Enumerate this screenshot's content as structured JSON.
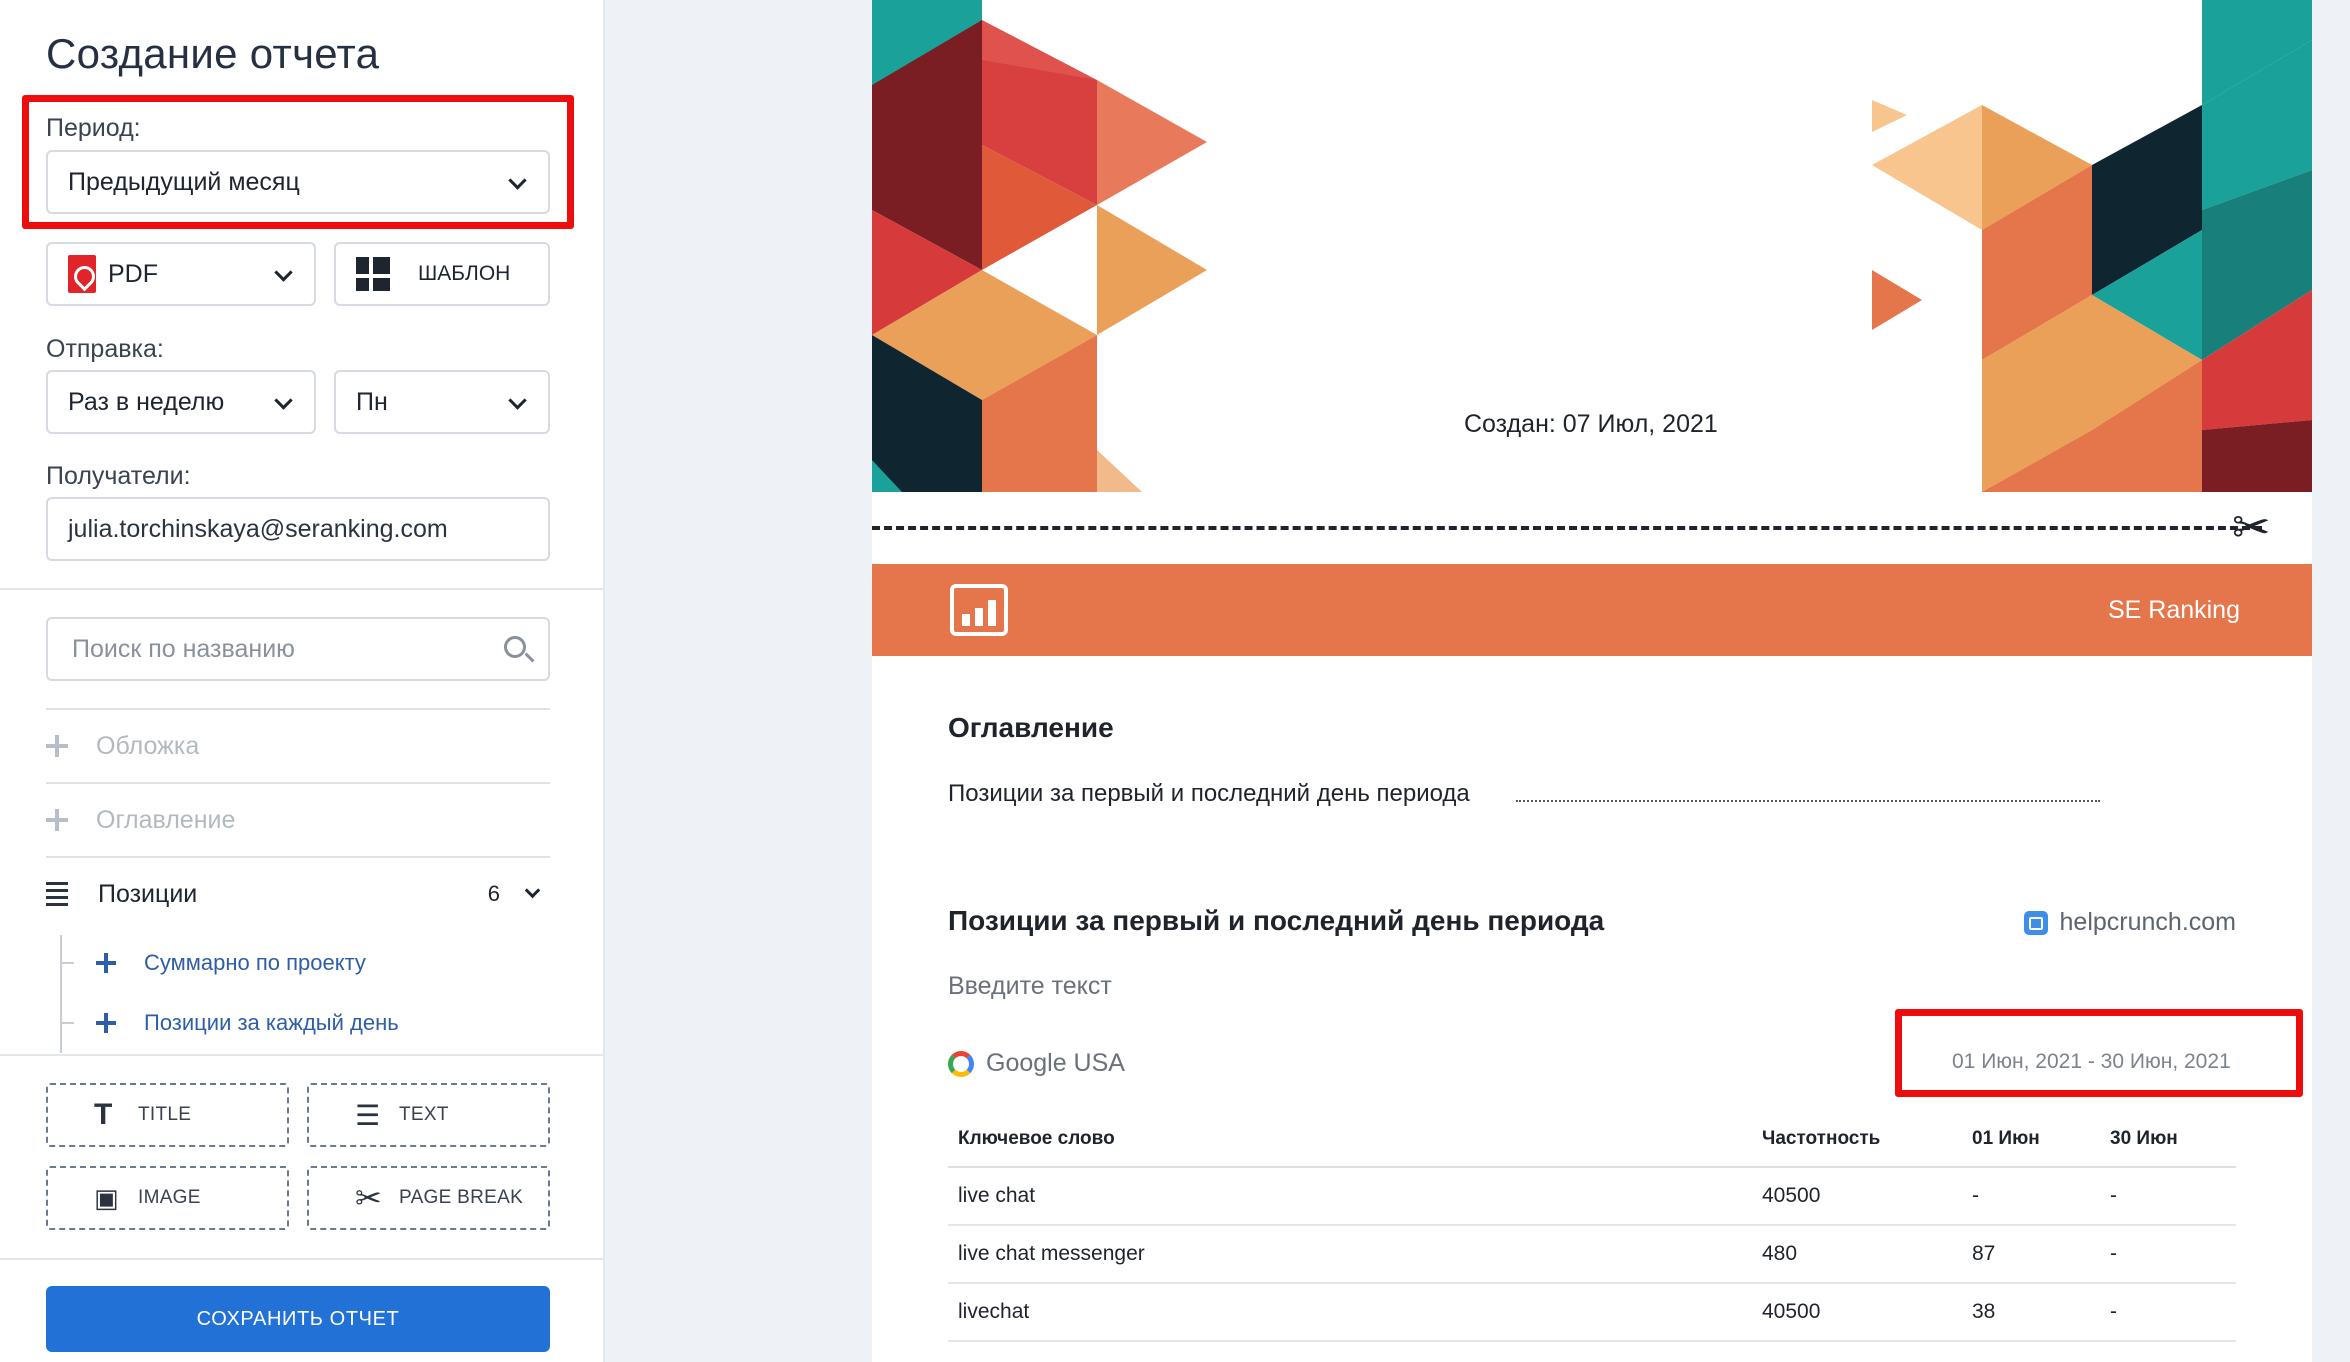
{
  "sidebar": {
    "title": "Создание отчета",
    "period": {
      "label": "Период:",
      "value": "Предыдущий месяц"
    },
    "format": {
      "value": "PDF",
      "template_label": "ШАБЛОН"
    },
    "sending": {
      "label": "Отправка:",
      "frequency": "Раз в неделю",
      "day": "Пн"
    },
    "recipients": {
      "label": "Получатели:",
      "value": "julia.torchinskaya@seranking.com"
    },
    "search": {
      "placeholder": "Поиск по названию"
    },
    "sections": [
      {
        "label": "Обложка",
        "icon": "move-icon"
      },
      {
        "label": "Оглавление",
        "icon": "move-icon"
      },
      {
        "label": "Позиции",
        "icon": "list-icon",
        "count": "6"
      }
    ],
    "subsections": [
      "Суммарно по проекту",
      "Позиции за каждый день"
    ],
    "tools": [
      "TITLE",
      "TEXT",
      "IMAGE",
      "PAGE BREAK"
    ],
    "save_label": "СОХРАНИТЬ ОТЧЕТ",
    "highlight_color": "#ee0d0d",
    "accent_color": "#2271d6"
  },
  "report": {
    "created": "Создан: 07 Июл, 2021",
    "brand": "SE Ranking",
    "banner_color": "#e5764b",
    "toc_title": "Оглавление",
    "toc_item": "Позиции за первый и последний день периода",
    "section_title": "Позиции за первый и последний день периода",
    "site": "helpcrunch.com",
    "enter_text": "Введите текст",
    "engine": "Google USA",
    "period": "01 Июн, 2021 - 30 Июн, 2021",
    "table": {
      "headers": [
        "Ключевое слово",
        "Частотность",
        "01 Июн",
        "30 Июн"
      ],
      "rows": [
        [
          "live chat",
          "40500",
          "-",
          "-"
        ],
        [
          "live chat messenger",
          "480",
          "87",
          "-"
        ],
        [
          "livechat",
          "40500",
          "38",
          "-"
        ]
      ]
    }
  }
}
